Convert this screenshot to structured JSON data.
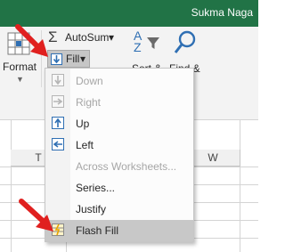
{
  "titlebar": {
    "user_name": "Sukma Naga"
  },
  "ribbon": {
    "format_label": "Format",
    "autosum_label": "AutoSum",
    "autosum_caret": "▾",
    "fill_label": "Fill",
    "fill_caret": "▾",
    "sort_label": "Sort &",
    "find_label": "Find &"
  },
  "sheet": {
    "col_t": "T",
    "col_w": "W"
  },
  "fill_menu": {
    "items": [
      {
        "label": "Down",
        "enabled": false,
        "icon": "fill-down-icon"
      },
      {
        "label": "Right",
        "enabled": false,
        "icon": "fill-right-icon"
      },
      {
        "label": "Up",
        "enabled": true,
        "icon": "fill-up-icon"
      },
      {
        "label": "Left",
        "enabled": true,
        "icon": "fill-left-icon"
      },
      {
        "label": "Across Worksheets...",
        "enabled": false
      },
      {
        "label": "Series...",
        "enabled": true
      },
      {
        "label": "Justify",
        "enabled": true
      },
      {
        "label": "Flash Fill",
        "enabled": true,
        "highlighted": true,
        "icon": "flash-fill-icon"
      }
    ]
  },
  "colors": {
    "excel_green": "#217346",
    "highlight": "#c8c8c8",
    "annotation_red": "#e0201f"
  }
}
